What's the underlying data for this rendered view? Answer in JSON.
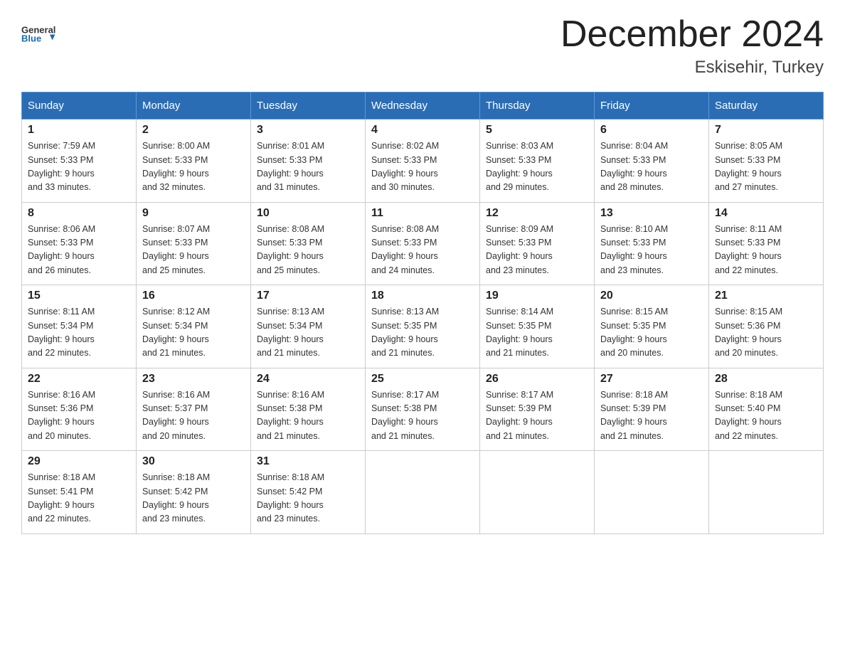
{
  "header": {
    "logo_general": "General",
    "logo_blue": "Blue",
    "month_title": "December 2024",
    "location": "Eskisehir, Turkey"
  },
  "weekdays": [
    "Sunday",
    "Monday",
    "Tuesday",
    "Wednesday",
    "Thursday",
    "Friday",
    "Saturday"
  ],
  "weeks": [
    [
      {
        "day": "1",
        "sunrise": "7:59 AM",
        "sunset": "5:33 PM",
        "daylight": "9 hours and 33 minutes."
      },
      {
        "day": "2",
        "sunrise": "8:00 AM",
        "sunset": "5:33 PM",
        "daylight": "9 hours and 32 minutes."
      },
      {
        "day": "3",
        "sunrise": "8:01 AM",
        "sunset": "5:33 PM",
        "daylight": "9 hours and 31 minutes."
      },
      {
        "day": "4",
        "sunrise": "8:02 AM",
        "sunset": "5:33 PM",
        "daylight": "9 hours and 30 minutes."
      },
      {
        "day": "5",
        "sunrise": "8:03 AM",
        "sunset": "5:33 PM",
        "daylight": "9 hours and 29 minutes."
      },
      {
        "day": "6",
        "sunrise": "8:04 AM",
        "sunset": "5:33 PM",
        "daylight": "9 hours and 28 minutes."
      },
      {
        "day": "7",
        "sunrise": "8:05 AM",
        "sunset": "5:33 PM",
        "daylight": "9 hours and 27 minutes."
      }
    ],
    [
      {
        "day": "8",
        "sunrise": "8:06 AM",
        "sunset": "5:33 PM",
        "daylight": "9 hours and 26 minutes."
      },
      {
        "day": "9",
        "sunrise": "8:07 AM",
        "sunset": "5:33 PM",
        "daylight": "9 hours and 25 minutes."
      },
      {
        "day": "10",
        "sunrise": "8:08 AM",
        "sunset": "5:33 PM",
        "daylight": "9 hours and 25 minutes."
      },
      {
        "day": "11",
        "sunrise": "8:08 AM",
        "sunset": "5:33 PM",
        "daylight": "9 hours and 24 minutes."
      },
      {
        "day": "12",
        "sunrise": "8:09 AM",
        "sunset": "5:33 PM",
        "daylight": "9 hours and 23 minutes."
      },
      {
        "day": "13",
        "sunrise": "8:10 AM",
        "sunset": "5:33 PM",
        "daylight": "9 hours and 23 minutes."
      },
      {
        "day": "14",
        "sunrise": "8:11 AM",
        "sunset": "5:33 PM",
        "daylight": "9 hours and 22 minutes."
      }
    ],
    [
      {
        "day": "15",
        "sunrise": "8:11 AM",
        "sunset": "5:34 PM",
        "daylight": "9 hours and 22 minutes."
      },
      {
        "day": "16",
        "sunrise": "8:12 AM",
        "sunset": "5:34 PM",
        "daylight": "9 hours and 21 minutes."
      },
      {
        "day": "17",
        "sunrise": "8:13 AM",
        "sunset": "5:34 PM",
        "daylight": "9 hours and 21 minutes."
      },
      {
        "day": "18",
        "sunrise": "8:13 AM",
        "sunset": "5:35 PM",
        "daylight": "9 hours and 21 minutes."
      },
      {
        "day": "19",
        "sunrise": "8:14 AM",
        "sunset": "5:35 PM",
        "daylight": "9 hours and 21 minutes."
      },
      {
        "day": "20",
        "sunrise": "8:15 AM",
        "sunset": "5:35 PM",
        "daylight": "9 hours and 20 minutes."
      },
      {
        "day": "21",
        "sunrise": "8:15 AM",
        "sunset": "5:36 PM",
        "daylight": "9 hours and 20 minutes."
      }
    ],
    [
      {
        "day": "22",
        "sunrise": "8:16 AM",
        "sunset": "5:36 PM",
        "daylight": "9 hours and 20 minutes."
      },
      {
        "day": "23",
        "sunrise": "8:16 AM",
        "sunset": "5:37 PM",
        "daylight": "9 hours and 20 minutes."
      },
      {
        "day": "24",
        "sunrise": "8:16 AM",
        "sunset": "5:38 PM",
        "daylight": "9 hours and 21 minutes."
      },
      {
        "day": "25",
        "sunrise": "8:17 AM",
        "sunset": "5:38 PM",
        "daylight": "9 hours and 21 minutes."
      },
      {
        "day": "26",
        "sunrise": "8:17 AM",
        "sunset": "5:39 PM",
        "daylight": "9 hours and 21 minutes."
      },
      {
        "day": "27",
        "sunrise": "8:18 AM",
        "sunset": "5:39 PM",
        "daylight": "9 hours and 21 minutes."
      },
      {
        "day": "28",
        "sunrise": "8:18 AM",
        "sunset": "5:40 PM",
        "daylight": "9 hours and 22 minutes."
      }
    ],
    [
      {
        "day": "29",
        "sunrise": "8:18 AM",
        "sunset": "5:41 PM",
        "daylight": "9 hours and 22 minutes."
      },
      {
        "day": "30",
        "sunrise": "8:18 AM",
        "sunset": "5:42 PM",
        "daylight": "9 hours and 23 minutes."
      },
      {
        "day": "31",
        "sunrise": "8:18 AM",
        "sunset": "5:42 PM",
        "daylight": "9 hours and 23 minutes."
      },
      null,
      null,
      null,
      null
    ]
  ],
  "labels": {
    "sunrise": "Sunrise:",
    "sunset": "Sunset:",
    "daylight": "Daylight:"
  }
}
